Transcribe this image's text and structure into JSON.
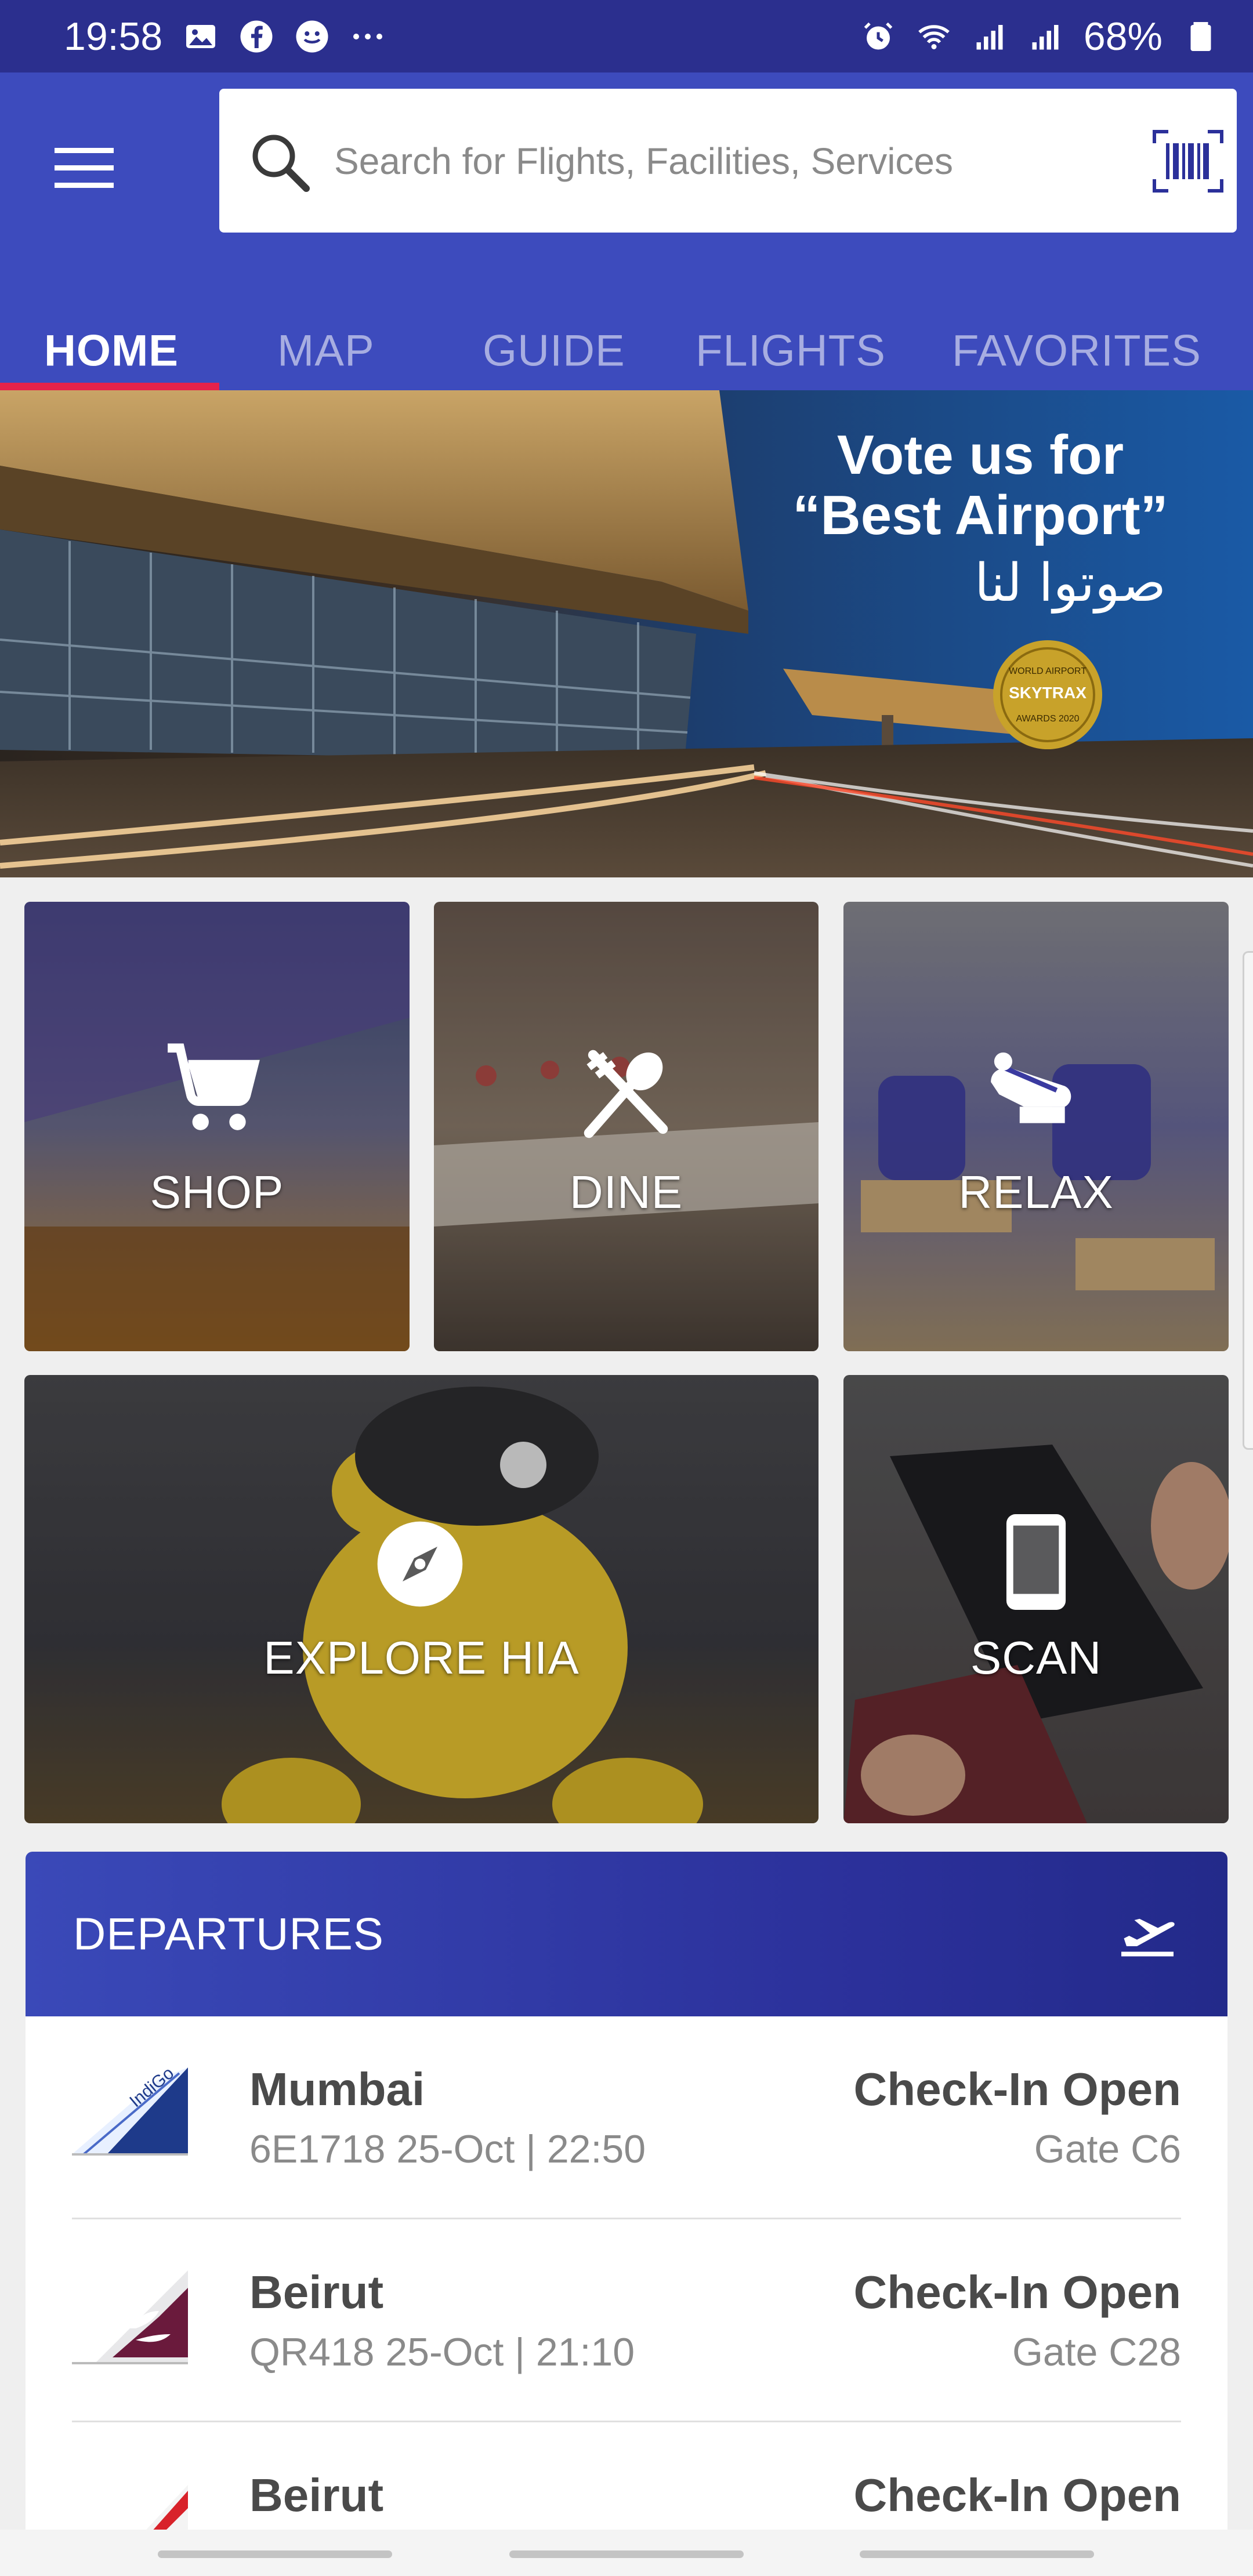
{
  "status_bar": {
    "time": "19:58",
    "battery": "68%",
    "left_icons": [
      "gallery-icon",
      "facebook-icon",
      "messenger-icon",
      "more-dots-icon"
    ],
    "right_icons": [
      "alarm-icon",
      "wifi-icon",
      "signal-icon",
      "signal-icon",
      "battery-icon"
    ]
  },
  "app_bar": {
    "search": {
      "placeholder": "Search for Flights, Facilities, Services",
      "value": ""
    },
    "tabs": [
      {
        "label": "HOME",
        "active": true
      },
      {
        "label": "MAP",
        "active": false
      },
      {
        "label": "GUIDE",
        "active": false
      },
      {
        "label": "FLIGHTS",
        "active": false
      },
      {
        "label": "FAVORITES",
        "active": false
      }
    ],
    "colors": {
      "primary": "#3d4bbd",
      "status": "#2b2f8e",
      "accent": "#e5224a"
    }
  },
  "banner": {
    "line1": "Vote us for",
    "line2": "“Best Airport”",
    "arabic": "صوتوا لنا",
    "badge_text": [
      "WORLD AIRPORT",
      "SKYTRAX",
      "AWARDS 2020"
    ]
  },
  "tiles": [
    {
      "label": "SHOP",
      "icon": "cart-icon"
    },
    {
      "label": "DINE",
      "icon": "cutlery-icon"
    },
    {
      "label": "RELAX",
      "icon": "lounge-icon"
    },
    {
      "label": "EXPLORE HIA",
      "icon": "compass-icon"
    },
    {
      "label": "SCAN",
      "icon": "phone-icon"
    }
  ],
  "departures": {
    "title": "DEPARTURES",
    "icon": "plane-departure-icon",
    "flights": [
      {
        "city": "Mumbai",
        "info": "6E1718   25-Oct | 22:50",
        "status": "Check-In Open",
        "gate": "Gate C6",
        "airline_logo": "indigo-logo"
      },
      {
        "city": "Beirut",
        "info": "QR418   25-Oct | 21:10",
        "status": "Check-In Open",
        "gate": "Gate C28",
        "airline_logo": "qatar-airways-logo"
      },
      {
        "city": "Beirut",
        "info": "",
        "status": "Check-In Open",
        "gate": "",
        "airline_logo": "middle-east-airlines-logo"
      }
    ]
  }
}
